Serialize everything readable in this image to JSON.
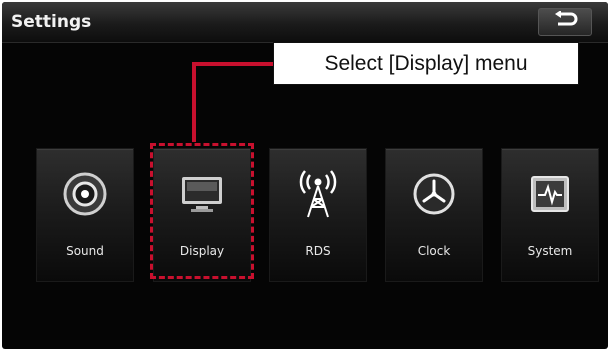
{
  "header": {
    "title": "Settings",
    "back_icon": "return-arrow-icon"
  },
  "tiles": [
    {
      "label": "Sound",
      "icon": "speaker-icon"
    },
    {
      "label": "Display",
      "icon": "monitor-icon"
    },
    {
      "label": "RDS",
      "icon": "radio-tower-icon"
    },
    {
      "label": "Clock",
      "icon": "clock-icon"
    },
    {
      "label": "System",
      "icon": "system-monitor-icon"
    }
  ],
  "annotation": {
    "text": "Select [Display] menu",
    "color": "#c8102e"
  }
}
